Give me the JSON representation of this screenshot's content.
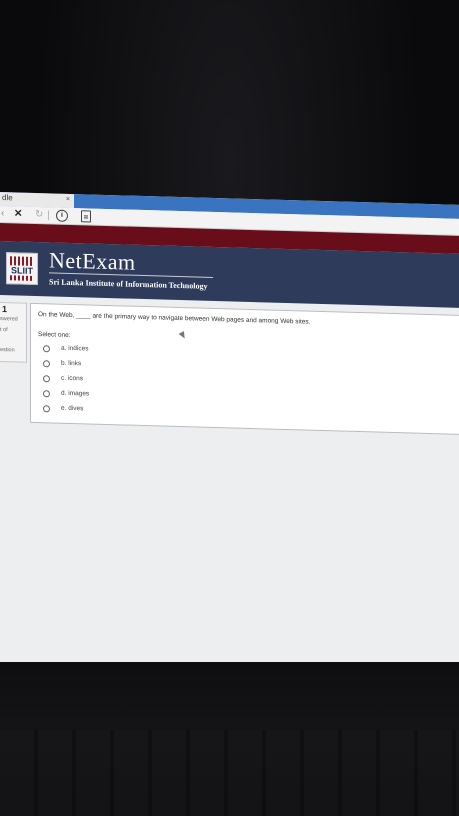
{
  "browser": {
    "tab_title": "dle",
    "tab_close": "×",
    "toolbar": {
      "back": "‹",
      "stop": "✕",
      "reload": "↻",
      "info": "i"
    }
  },
  "header": {
    "brand_title": "NetExam",
    "brand_subtitle": "Sri Lanka Institute of Information Technology",
    "logo_text": "SLIIT"
  },
  "question_info": {
    "number": "1",
    "status": "swered",
    "marks": "t of",
    "flag": "estion"
  },
  "question": {
    "text": "On the Web, ____ are the primary way to navigate between Web pages and among Web sites.",
    "prompt": "Select one:",
    "options": [
      {
        "label": "a. indices"
      },
      {
        "label": "b. links"
      },
      {
        "label": "c. icons"
      },
      {
        "label": "d. images"
      },
      {
        "label": "e. dives"
      }
    ]
  }
}
